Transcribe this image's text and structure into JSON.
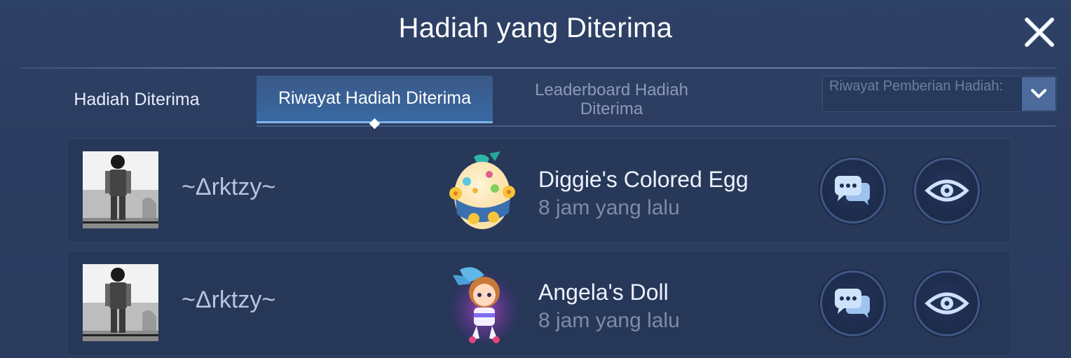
{
  "header": {
    "title": "Hadiah yang Diterima"
  },
  "tabs": [
    {
      "label": "Hadiah Diterima",
      "active": false
    },
    {
      "label": "Riwayat Hadiah Diterima",
      "active": true
    },
    {
      "label": "Leaderboard Hadiah Diterima",
      "active": false
    }
  ],
  "dropdown": {
    "label": "Riwayat Pemberian Hadiah:"
  },
  "rows": [
    {
      "username": "~Δrktzy~",
      "gift_name": "Diggie's Colored Egg",
      "time": "8 jam yang lalu",
      "gift_icon": "colored-egg-icon"
    },
    {
      "username": "~Δrktzy~",
      "gift_name": "Angela's Doll",
      "time": "8 jam yang lalu",
      "gift_icon": "doll-icon"
    }
  ],
  "colors": {
    "background": "#2c3d5f",
    "active_tab": "#3f78b9",
    "muted_text": "#7f8ba5"
  }
}
